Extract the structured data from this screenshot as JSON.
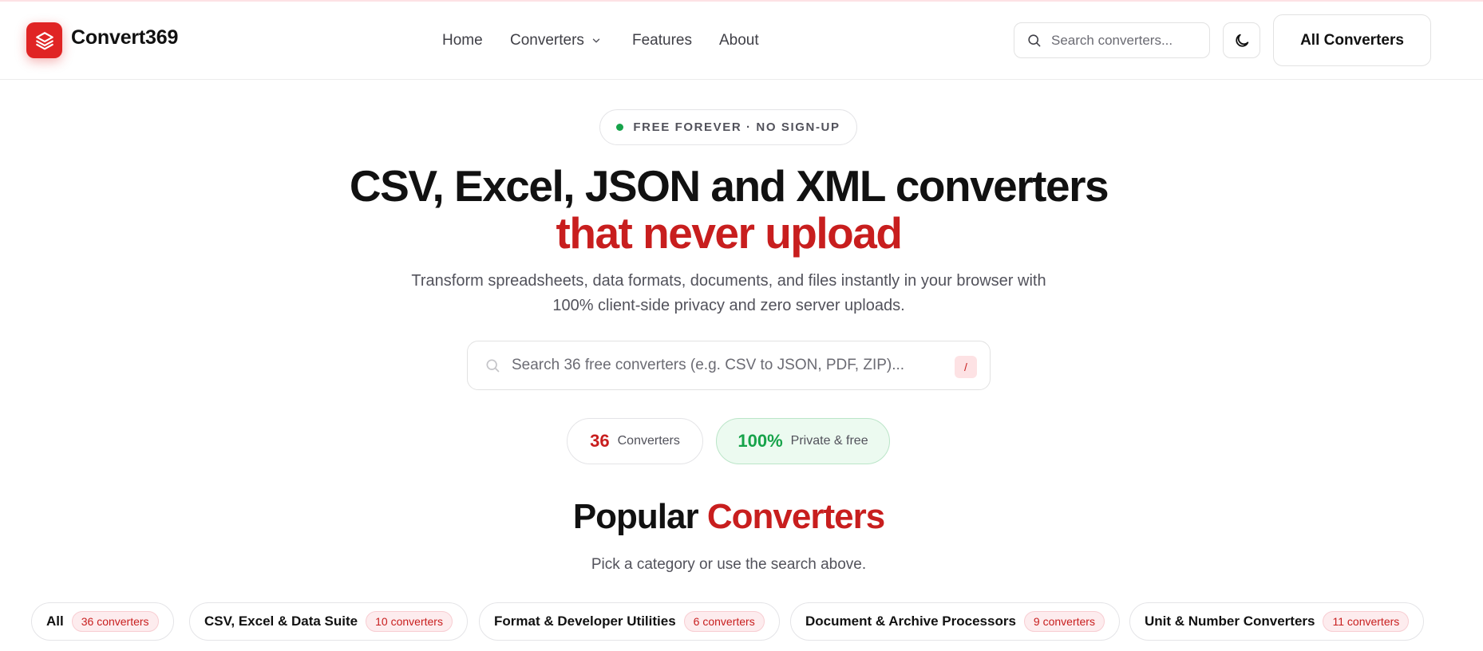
{
  "header": {
    "brand": "Convert369",
    "nav": {
      "home": "Home",
      "converters": "Converters",
      "features": "Features",
      "about": "About"
    },
    "search_placeholder": "Search converters...",
    "all_converters_label": "All Converters"
  },
  "hero": {
    "badge": "FREE FOREVER · NO SIGN-UP",
    "title_line1": "CSV, Excel, JSON and XML converters",
    "title_line2": "that never upload",
    "subtitle": "Transform spreadsheets, data formats, documents, and files instantly in your browser with 100% client-side privacy and zero server uploads.",
    "search_placeholder": "Search 36 free converters (e.g. CSV to JSON, PDF, ZIP)...",
    "search_shortcut": "/",
    "stats": [
      {
        "value": "36",
        "label": "Converters"
      },
      {
        "value": "100%",
        "label": "Private & free"
      }
    ]
  },
  "popular": {
    "title_a": "Popular",
    "title_b": "Converters",
    "subtitle": "Pick a category or use the search above.",
    "categories": [
      {
        "name": "All",
        "count": "36 converters"
      },
      {
        "name": "CSV, Excel & Data Suite",
        "count": "10 converters"
      },
      {
        "name": "Format & Developer Utilities",
        "count": "6 converters"
      },
      {
        "name": "Document & Archive Processors",
        "count": "9 converters"
      },
      {
        "name": "Unit & Number Converters",
        "count": "11 converters"
      }
    ]
  },
  "colors": {
    "accent": "#c81e1e",
    "logo_bg": "#e02424",
    "success": "#16a34a"
  },
  "icons": {
    "logo": "layers-icon",
    "search": "search-icon",
    "theme": "moon-icon",
    "dropdown": "chevron-down-icon"
  }
}
